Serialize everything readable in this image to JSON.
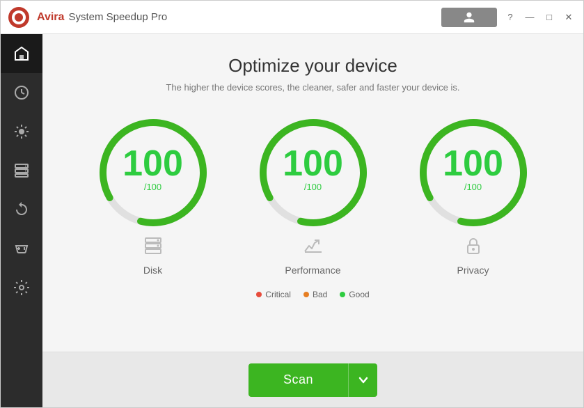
{
  "titleBar": {
    "brand": "Avira",
    "appName": "System Speedup Pro",
    "questionMark": "?",
    "minimize": "—",
    "maximize": "□",
    "close": "✕"
  },
  "sidebar": {
    "items": [
      {
        "id": "home",
        "icon": "home"
      },
      {
        "id": "clock",
        "icon": "clock"
      },
      {
        "id": "optimizer",
        "icon": "optimizer"
      },
      {
        "id": "disk",
        "icon": "disk"
      },
      {
        "id": "restore",
        "icon": "restore"
      },
      {
        "id": "gaming",
        "icon": "gaming"
      },
      {
        "id": "settings",
        "icon": "settings"
      }
    ]
  },
  "content": {
    "title": "Optimize your device",
    "subtitle": "The higher the device scores, the cleaner, safer and faster your device is.",
    "gauges": [
      {
        "id": "disk",
        "score": "100",
        "denom": "/100",
        "label": "Disk",
        "icon": "disk-icon"
      },
      {
        "id": "performance",
        "score": "100",
        "denom": "/100",
        "label": "Performance",
        "icon": "performance-icon"
      },
      {
        "id": "privacy",
        "score": "100",
        "denom": "/100",
        "label": "Privacy",
        "icon": "privacy-icon"
      }
    ],
    "legend": [
      {
        "label": "Critical",
        "color": "#e74c3c"
      },
      {
        "label": "Bad",
        "color": "#e67e22"
      },
      {
        "label": "Good",
        "color": "#2ecc40"
      }
    ]
  },
  "bottomBar": {
    "scanLabel": "Scan"
  }
}
